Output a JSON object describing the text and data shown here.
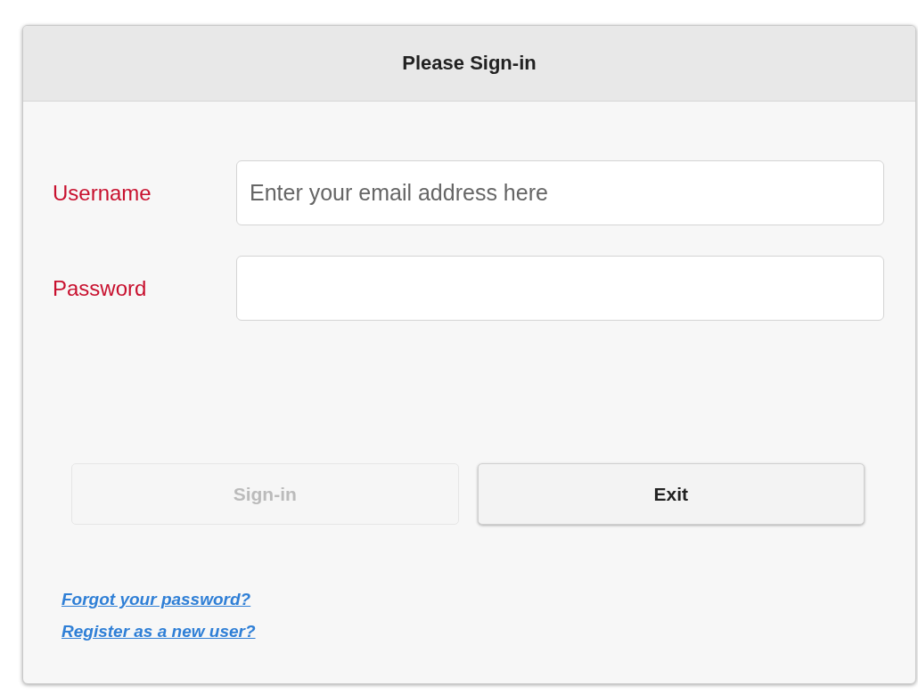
{
  "dialog": {
    "title": "Please Sign-in"
  },
  "fields": [
    {
      "label": "Username",
      "placeholder": "Enter your email address here"
    },
    {
      "label": "Password"
    }
  ],
  "buttons": [
    {
      "label": "Sign-in",
      "disabled": true
    },
    {
      "label": "Exit",
      "disabled": false
    }
  ],
  "links": [
    "Forgot your password?",
    "Register as a new user?"
  ]
}
